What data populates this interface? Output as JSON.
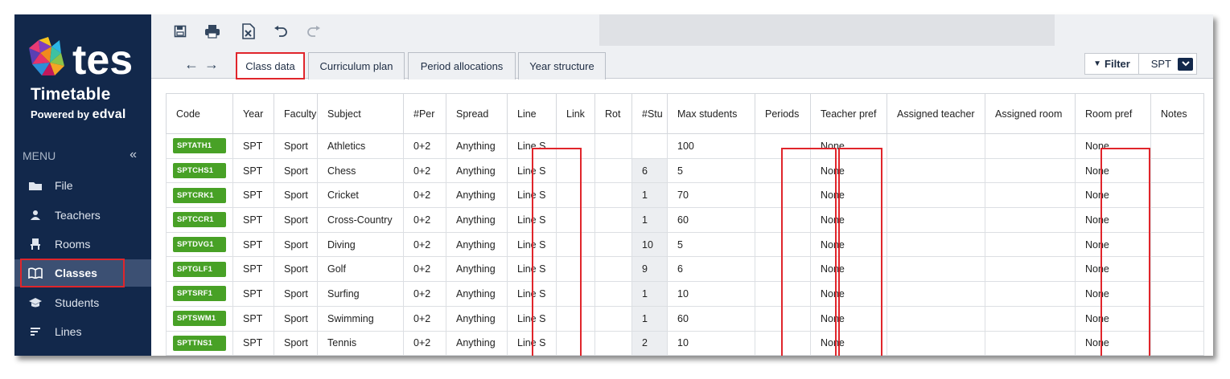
{
  "brand": {
    "title": "Timetable",
    "powered_prefix": "Powered by",
    "powered_name": "edval",
    "logo_text": "tes"
  },
  "sidebar": {
    "menu_label": "MENU",
    "collapse_icon": "«",
    "items": [
      {
        "label": "File",
        "icon": "folder-icon"
      },
      {
        "label": "Teachers",
        "icon": "person-icon"
      },
      {
        "label": "Rooms",
        "icon": "chair-icon"
      },
      {
        "label": "Classes",
        "icon": "book-icon",
        "active": true
      },
      {
        "label": "Students",
        "icon": "graduation-cap-icon"
      },
      {
        "label": "Lines",
        "icon": "lines-icon"
      }
    ]
  },
  "toolbar": {
    "icons": [
      "save-icon",
      "print-icon",
      "export-file-icon",
      "undo-icon",
      "redo-icon"
    ]
  },
  "tabs": [
    {
      "label": "Class data",
      "active": true
    },
    {
      "label": "Curriculum plan"
    },
    {
      "label": "Period allocations"
    },
    {
      "label": "Year structure"
    }
  ],
  "filter": {
    "label": "Filter",
    "selected": "SPT"
  },
  "table": {
    "columns": [
      "Code",
      "Year",
      "Faculty",
      "Subject",
      "#Per",
      "Spread",
      "Line",
      "Link",
      "Rot",
      "#Stu",
      "Max students",
      "Periods",
      "Teacher pref",
      "Assigned teacher",
      "Assigned room",
      "Room pref",
      "Notes"
    ],
    "rows": [
      {
        "code": "SPTATH1",
        "year": "SPT",
        "faculty": "Sport",
        "subject": "Athletics",
        "per": "0+2",
        "spread": "Anything",
        "line": "Line S",
        "link": "",
        "rot": "",
        "stu": "",
        "max": "100",
        "periods": "",
        "teacher_pref": "None",
        "assigned_teacher": "",
        "assigned_room": "",
        "room_pref": "None",
        "notes": ""
      },
      {
        "code": "SPTCHS1",
        "year": "SPT",
        "faculty": "Sport",
        "subject": "Chess",
        "per": "0+2",
        "spread": "Anything",
        "line": "Line S",
        "link": "",
        "rot": "",
        "stu": "6",
        "max": "5",
        "periods": "",
        "teacher_pref": "None",
        "assigned_teacher": "",
        "assigned_room": "",
        "room_pref": "None",
        "notes": ""
      },
      {
        "code": "SPTCRK1",
        "year": "SPT",
        "faculty": "Sport",
        "subject": "Cricket",
        "per": "0+2",
        "spread": "Anything",
        "line": "Line S",
        "link": "",
        "rot": "",
        "stu": "1",
        "max": "70",
        "periods": "",
        "teacher_pref": "None",
        "assigned_teacher": "",
        "assigned_room": "",
        "room_pref": "None",
        "notes": ""
      },
      {
        "code": "SPTCCR1",
        "year": "SPT",
        "faculty": "Sport",
        "subject": "Cross-Country",
        "per": "0+2",
        "spread": "Anything",
        "line": "Line S",
        "link": "",
        "rot": "",
        "stu": "1",
        "max": "60",
        "periods": "",
        "teacher_pref": "None",
        "assigned_teacher": "",
        "assigned_room": "",
        "room_pref": "None",
        "notes": ""
      },
      {
        "code": "SPTDVG1",
        "year": "SPT",
        "faculty": "Sport",
        "subject": "Diving",
        "per": "0+2",
        "spread": "Anything",
        "line": "Line S",
        "link": "",
        "rot": "",
        "stu": "10",
        "max": "5",
        "periods": "",
        "teacher_pref": "None",
        "assigned_teacher": "",
        "assigned_room": "",
        "room_pref": "None",
        "notes": ""
      },
      {
        "code": "SPTGLF1",
        "year": "SPT",
        "faculty": "Sport",
        "subject": "Golf",
        "per": "0+2",
        "spread": "Anything",
        "line": "Line S",
        "link": "",
        "rot": "",
        "stu": "9",
        "max": "6",
        "periods": "",
        "teacher_pref": "None",
        "assigned_teacher": "",
        "assigned_room": "",
        "room_pref": "None",
        "notes": ""
      },
      {
        "code": "SPTSRF1",
        "year": "SPT",
        "faculty": "Sport",
        "subject": "Surfing",
        "per": "0+2",
        "spread": "Anything",
        "line": "Line S",
        "link": "",
        "rot": "",
        "stu": "1",
        "max": "10",
        "periods": "",
        "teacher_pref": "None",
        "assigned_teacher": "",
        "assigned_room": "",
        "room_pref": "None",
        "notes": ""
      },
      {
        "code": "SPTSWM1",
        "year": "SPT",
        "faculty": "Sport",
        "subject": "Swimming",
        "per": "0+2",
        "spread": "Anything",
        "line": "Line S",
        "link": "",
        "rot": "",
        "stu": "1",
        "max": "60",
        "periods": "",
        "teacher_pref": "None",
        "assigned_teacher": "",
        "assigned_room": "",
        "room_pref": "None",
        "notes": ""
      },
      {
        "code": "SPTTNS1",
        "year": "SPT",
        "faculty": "Sport",
        "subject": "Tennis",
        "per": "0+2",
        "spread": "Anything",
        "line": "Line S",
        "link": "",
        "rot": "",
        "stu": "2",
        "max": "10",
        "periods": "",
        "teacher_pref": "None",
        "assigned_teacher": "",
        "assigned_room": "",
        "room_pref": "None",
        "notes": ""
      }
    ]
  },
  "colors": {
    "sidebar_bg": "#12284b",
    "code_badge": "#48a126",
    "highlight": "#e0252b"
  }
}
